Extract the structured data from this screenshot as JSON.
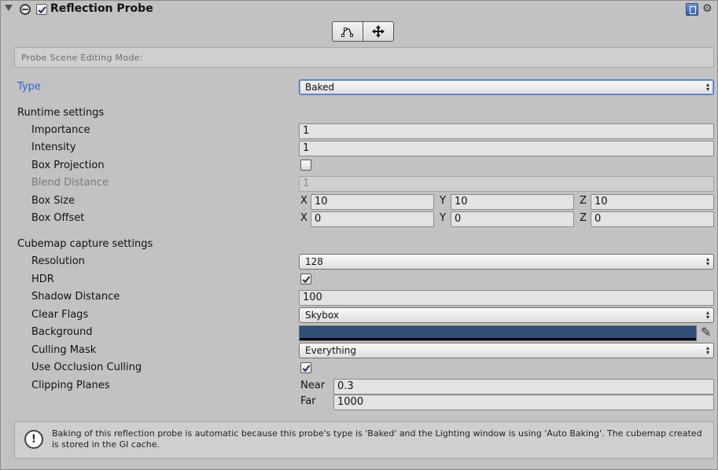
{
  "header": {
    "title": "Reflection Probe",
    "enabled": true,
    "icons": [
      "foldout-arrow-icon",
      "reflection-probe-icon",
      "help-book-icon",
      "gear-icon"
    ]
  },
  "edit_mode": {
    "buttons": [
      "edit-bounds-icon",
      "move-center-icon"
    ],
    "label": "Probe Scene Editing Mode:"
  },
  "type": {
    "label": "Type",
    "value": "Baked"
  },
  "runtime": {
    "section": "Runtime settings",
    "importance": {
      "label": "Importance",
      "value": "1"
    },
    "intensity": {
      "label": "Intensity",
      "value": "1"
    },
    "box_projection": {
      "label": "Box Projection",
      "checked": false
    },
    "blend_distance": {
      "label": "Blend Distance",
      "value": "1"
    },
    "box_size": {
      "label": "Box Size",
      "x": "10",
      "y": "10",
      "z": "10"
    },
    "box_offset": {
      "label": "Box Offset",
      "x": "0",
      "y": "0",
      "z": "0"
    },
    "axes": {
      "x": "X",
      "y": "Y",
      "z": "Z"
    }
  },
  "cubemap": {
    "section": "Cubemap capture settings",
    "resolution": {
      "label": "Resolution",
      "value": "128"
    },
    "hdr": {
      "label": "HDR",
      "checked": true
    },
    "shadow_distance": {
      "label": "Shadow Distance",
      "value": "100"
    },
    "clear_flags": {
      "label": "Clear Flags",
      "value": "Skybox"
    },
    "background": {
      "label": "Background",
      "color": "#2f4f79"
    },
    "culling_mask": {
      "label": "Culling Mask",
      "value": "Everything"
    },
    "occlusion": {
      "label": "Use Occlusion Culling",
      "checked": true
    },
    "clipping": {
      "label": "Clipping Planes",
      "near_label": "Near",
      "near": "0.3",
      "far_label": "Far",
      "far": "1000"
    }
  },
  "help": {
    "text": "Baking of this reflection probe is automatic because this probe's type is 'Baked' and the Lighting window is using 'Auto Baking'. The cubemap created is stored in the GI cache."
  },
  "colors": {
    "accent": "#2a64d8",
    "panel": "#c2c2c2"
  }
}
